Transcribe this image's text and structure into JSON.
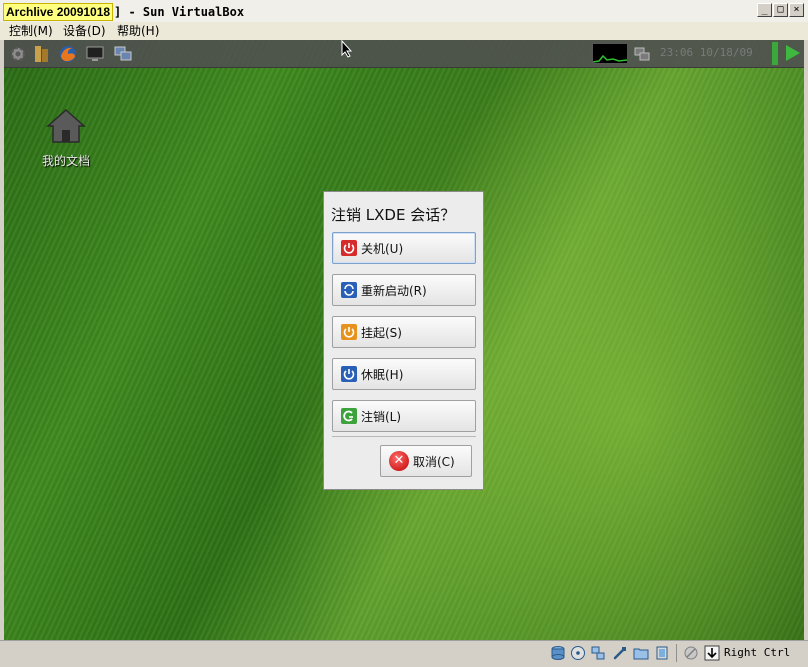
{
  "window": {
    "title_highlight": "Archlive 20091018",
    "title_rest": "] - Sun VirtualBox",
    "btn_minimize": "_",
    "btn_maximize": "□",
    "btn_close": "×"
  },
  "menubar": {
    "items": [
      {
        "label": "控制(M)"
      },
      {
        "label": "设备(D)"
      },
      {
        "label": "帮助(H)"
      }
    ]
  },
  "guest": {
    "panel": {
      "clock": "23:06 10/18/09"
    },
    "desktop": {
      "icons": [
        {
          "label": "我的文档"
        }
      ]
    },
    "dialog": {
      "title": "注销 LXDE 会话？",
      "buttons": [
        {
          "label": "关机(U)",
          "color": "#d62b2b",
          "icon": "power-icon"
        },
        {
          "label": "重新启动(R)",
          "color": "#2a5fb8",
          "icon": "restart-icon"
        },
        {
          "label": "挂起(S)",
          "color": "#e8921e",
          "icon": "suspend-icon"
        },
        {
          "label": "休眠(H)",
          "color": "#2a5fb8",
          "icon": "hibernate-icon"
        },
        {
          "label": "注销(L)",
          "color": "#3ca23c",
          "icon": "logout-icon"
        }
      ],
      "cancel": {
        "label": "取消(C)",
        "icon": "cancel-icon"
      }
    }
  },
  "statusbar": {
    "host_key": "Right Ctrl"
  }
}
